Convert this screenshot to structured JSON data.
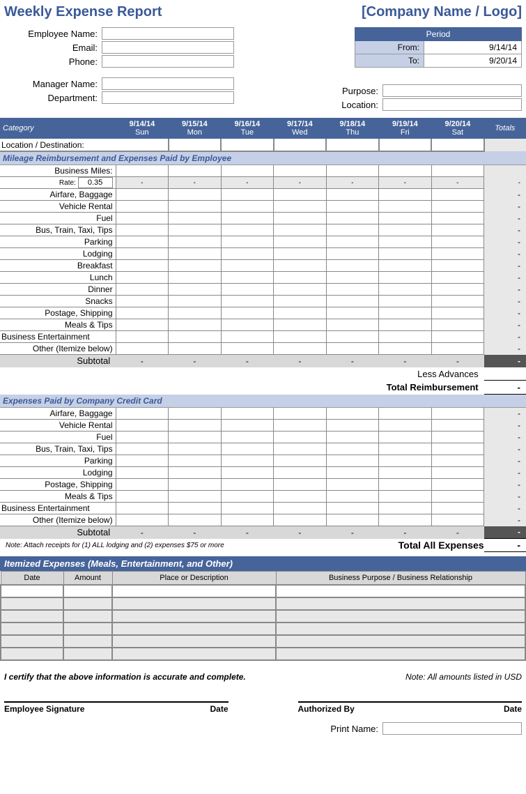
{
  "header": {
    "title": "Weekly Expense Report",
    "company": "[Company Name / Logo]"
  },
  "employee": {
    "name_label": "Employee Name:",
    "email_label": "Email:",
    "phone_label": "Phone:",
    "manager_label": "Manager Name:",
    "department_label": "Department:"
  },
  "period": {
    "title": "Period",
    "from_label": "From:",
    "from": "9/14/14",
    "to_label": "To:",
    "to": "9/20/14"
  },
  "purpose": {
    "purpose_label": "Purpose:",
    "location_label": "Location:"
  },
  "columns": {
    "category": "Category",
    "days": [
      {
        "date": "9/14/14",
        "day": "Sun"
      },
      {
        "date": "9/15/14",
        "day": "Mon"
      },
      {
        "date": "9/16/14",
        "day": "Tue"
      },
      {
        "date": "9/17/14",
        "day": "Wed"
      },
      {
        "date": "9/18/14",
        "day": "Thu"
      },
      {
        "date": "9/19/14",
        "day": "Fri"
      },
      {
        "date": "9/20/14",
        "day": "Sat"
      }
    ],
    "totals": "Totals"
  },
  "locdest": "Location / Destination:",
  "section1": {
    "title": "Mileage Reimbursement and Expenses Paid by Employee",
    "business_miles": "Business Miles:",
    "rate_label": "Rate:",
    "rate": "0.35",
    "rows": [
      "Airfare, Baggage",
      "Vehicle Rental",
      "Fuel",
      "Bus, Train, Taxi, Tips",
      "Parking",
      "Lodging",
      "Breakfast",
      "Lunch",
      "Dinner",
      "Snacks",
      "Postage, Shipping",
      "Meals & Tips",
      "Business Entertainment",
      "Other (Itemize below)"
    ],
    "subtotal": "Subtotal",
    "less_advances": "Less Advances",
    "total_reimbursement": "Total Reimbursement"
  },
  "section2": {
    "title": "Expenses Paid by Company Credit Card",
    "rows": [
      "Airfare, Baggage",
      "Vehicle Rental",
      "Fuel",
      "Bus, Train, Taxi, Tips",
      "Parking",
      "Lodging",
      "Postage, Shipping",
      "Meals & Tips",
      "Business Entertainment",
      "Other (Itemize below)"
    ],
    "subtotal": "Subtotal",
    "note": "Note:  Attach receipts for (1) ALL lodging and (2) expenses $75 or more",
    "total_all": "Total All Expenses"
  },
  "itemized": {
    "title": "Itemized Expenses (Meals, Entertainment, and Other)",
    "cols": {
      "date": "Date",
      "amount": "Amount",
      "place": "Place or Description",
      "purpose": "Business Purpose / Business Relationship"
    }
  },
  "cert": {
    "text": "I certify that the above information is accurate and complete.",
    "usd": "Note: All amounts listed in USD"
  },
  "sig": {
    "emp": "Employee Signature",
    "date": "Date",
    "auth": "Authorized By",
    "print": "Print Name:"
  },
  "dash": "-"
}
